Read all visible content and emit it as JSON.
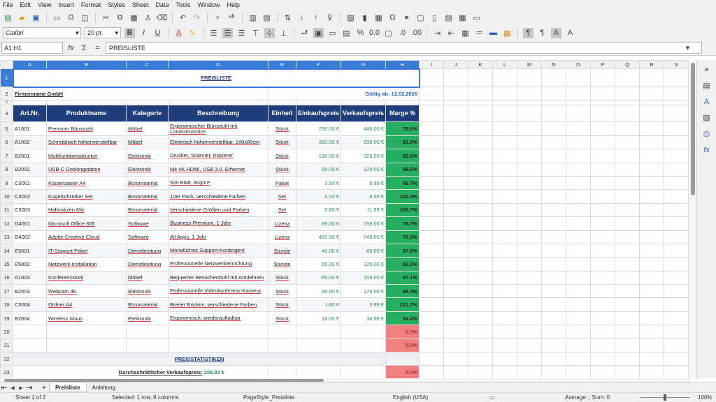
{
  "menu": [
    "File",
    "Edit",
    "View",
    "Insert",
    "Format",
    "Styles",
    "Sheet",
    "Data",
    "Tools",
    "Window",
    "Help"
  ],
  "font": {
    "name": "Calibri",
    "size": "20 pt"
  },
  "namebox": "A1:H1",
  "formula": "PREISLISTE",
  "columns": [
    "A",
    "B",
    "C",
    "D",
    "E",
    "F",
    "G",
    "H",
    "I",
    "J",
    "K",
    "L",
    "M",
    "N",
    "O",
    "P",
    "Q",
    "R",
    "S"
  ],
  "title": "PREISLISTE",
  "company": "Firmenname GmbH",
  "valid": "Gültig ab: 12.02.2026",
  "headers": [
    "Art.Nr.",
    "Produktname",
    "Kategorie",
    "Beschreibung",
    "Einheit",
    "Einkaufspreis",
    "Verkaufspreis",
    "Marge %"
  ],
  "rows": [
    {
      "n": "5",
      "a": "A1001",
      "b": "Premium Bürostuhl",
      "c": "Möbel",
      "d": "Ergonomischer Bürostuhl mit Lordosenstütze",
      "e": "Stück",
      "f": "250.00 €",
      "g": "449.00 €",
      "h": "79.6%"
    },
    {
      "n": "6",
      "a": "A1002",
      "b": "Schreibtisch höhenverstellbar",
      "c": "Möbel",
      "d": "Elektrisch höhenverstellbar, 160x80cm",
      "e": "Stück",
      "f": "380.00 €",
      "g": "699.00 €",
      "h": "83.9%"
    },
    {
      "n": "7",
      "a": "B2001",
      "b": "Multifunktionsdrucker",
      "c": "Elektronik",
      "d": "Drucker, Scanner, Kopierer",
      "e": "Stück",
      "f": "180.00 €",
      "g": "329.00 €",
      "h": "82.8%"
    },
    {
      "n": "8",
      "a": "B2002",
      "b": "USB-C Dockingstation",
      "c": "Elektronik",
      "d": "Mit 4K HDMI, USB 3.0, Ethernet",
      "e": "Stück",
      "f": "65.00 €",
      "g": "129.00 €",
      "h": "98.5%"
    },
    {
      "n": "9",
      "a": "C3001",
      "b": "Kopierpapier A4",
      "c": "Büromaterial",
      "d": "500 Blatt, 80g/m²",
      "e": "Paket",
      "f": "3.50 €",
      "g": "6.99 €",
      "h": "99.7%"
    },
    {
      "n": "10",
      "a": "C3002",
      "b": "Kugelschreiber Set",
      "c": "Büromaterial",
      "d": "10er Pack, verschiedene Farben",
      "e": "Set",
      "f": "4.20 €",
      "g": "8.50 €",
      "h": "102.4%"
    },
    {
      "n": "11",
      "a": "C3003",
      "b": "Haftnotizen Mix",
      "c": "Büromaterial",
      "d": "Verschiedene Größen und Farben",
      "e": "Set",
      "f": "5.80 €",
      "g": "11.99 €",
      "h": "106.7%"
    },
    {
      "n": "12",
      "a": "D4001",
      "b": "Microsoft Office 365",
      "c": "Software",
      "d": "Business Premium, 1 Jahr",
      "e": "Lizenz",
      "f": "89.00 €",
      "g": "159.00 €",
      "h": "78.7%"
    },
    {
      "n": "13",
      "a": "D4002",
      "b": "Adobe Creative Cloud",
      "c": "Software",
      "d": "All Apps, 1 Jahr",
      "e": "Lizenz",
      "f": "420.00 €",
      "g": "749.00 €",
      "h": "78.3%"
    },
    {
      "n": "14",
      "a": "E5001",
      "b": "IT-Support Paket",
      "c": "Dienstleistung",
      "d": "Monatliches Support-Kontingent",
      "e": "Stunde",
      "f": "45.00 €",
      "g": "89.00 €",
      "h": "97.8%"
    },
    {
      "n": "15",
      "a": "E5002",
      "b": "Netzwerk-Installation",
      "c": "Dienstleistung",
      "d": "Professionelle Netzwerkeinrichtung",
      "e": "Stunde",
      "f": "65.00 €",
      "g": "125.00 €",
      "h": "92.3%"
    },
    {
      "n": "16",
      "a": "A1003",
      "b": "Konferenzstuhl",
      "c": "Möbel",
      "d": "Bequemer Besucherstuhl mit Armlehnen",
      "e": "Stück",
      "f": "85.00 €",
      "g": "159.00 €",
      "h": "87.1%"
    },
    {
      "n": "17",
      "a": "B2003",
      "b": "Webcam 4K",
      "c": "Elektronik",
      "d": "Professionelle Videokonferenz-Kamera",
      "e": "Stück",
      "f": "95.00 €",
      "g": "179.00 €",
      "h": "88.4%"
    },
    {
      "n": "18",
      "a": "C3004",
      "b": "Ordner A4",
      "c": "Büromaterial",
      "d": "Breiter Rücken, verschiedene Farben",
      "e": "Stück",
      "f": "1.80 €",
      "g": "3.99 €",
      "h": "121.7%"
    },
    {
      "n": "19",
      "a": "B2004",
      "b": "Wireless Maus",
      "c": "Elektronik",
      "d": "Ergonomisch, wiederaufladbar",
      "e": "Stück",
      "f": "18.00 €",
      "g": "34.99 €",
      "h": "94.4%"
    }
  ],
  "zero": "0.0%",
  "stats_title": "PREISSTATISTIKEN",
  "avg_label": "Durchschnittlicher Verkaufspreis:",
  "avg_value": "208.83 €",
  "tabs": [
    "Preisliste",
    "Anleitung"
  ],
  "status": {
    "sheet": "Sheet 1 of 2",
    "selected": "Selected: 1 row, 8 columns",
    "style": "PageStyle_Preisliste",
    "lang": "English (USA)",
    "sum": "Average: ; Sum: 0",
    "zoom": "100%"
  }
}
